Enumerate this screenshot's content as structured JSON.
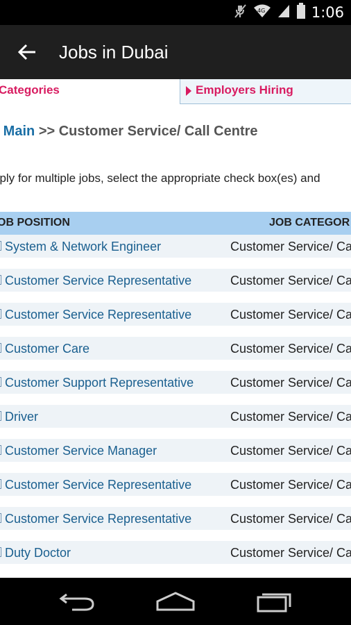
{
  "status_bar": {
    "time": "1:06",
    "icons": [
      "muted-icon",
      "wifi-icon",
      "signal-icon",
      "battery-icon"
    ]
  },
  "app_bar": {
    "title": "Jobs in Dubai",
    "back_icon": "arrow-left-icon"
  },
  "tabs": [
    {
      "label": "Categories"
    },
    {
      "label": "Employers Hiring"
    }
  ],
  "breadcrumb": {
    "link": "s Main",
    "separator": ">>",
    "current": "Customer Service/ Call Centre"
  },
  "instructions": "pply for multiple jobs, select the appropriate check box(es) and",
  "table": {
    "headers": [
      "OB POSITION",
      "JOB CATEGOR"
    ],
    "rows": [
      {
        "position": "System & Network Engineer",
        "category": "Customer Service/ Ca"
      },
      {
        "position": "Customer Service Representative",
        "category": "Customer Service/ Ca"
      },
      {
        "position": "Customer Service Representative",
        "category": "Customer Service/ Ca"
      },
      {
        "position": "Customer Care",
        "category": "Customer Service/ Ca"
      },
      {
        "position": "Customer Support Representative",
        "category": "Customer Service/ Ca"
      },
      {
        "position": "Driver",
        "category": "Customer Service/ Ca"
      },
      {
        "position": "Customer Service Manager",
        "category": "Customer Service/ Ca"
      },
      {
        "position": "Customer Service Representative",
        "category": "Customer Service/ Ca"
      },
      {
        "position": "Customer Service Representative",
        "category": "Customer Service/ Ca"
      },
      {
        "position": "Duty Doctor",
        "category": "Customer Service/ Ca"
      }
    ]
  },
  "nav_bar": {
    "icons": [
      "back-nav-icon",
      "home-nav-icon",
      "recents-nav-icon"
    ]
  },
  "colors": {
    "accent": "#d81b60",
    "link": "#1a5f8f",
    "header_bg": "#a8cff0",
    "appbar": "#1f1f1f"
  }
}
